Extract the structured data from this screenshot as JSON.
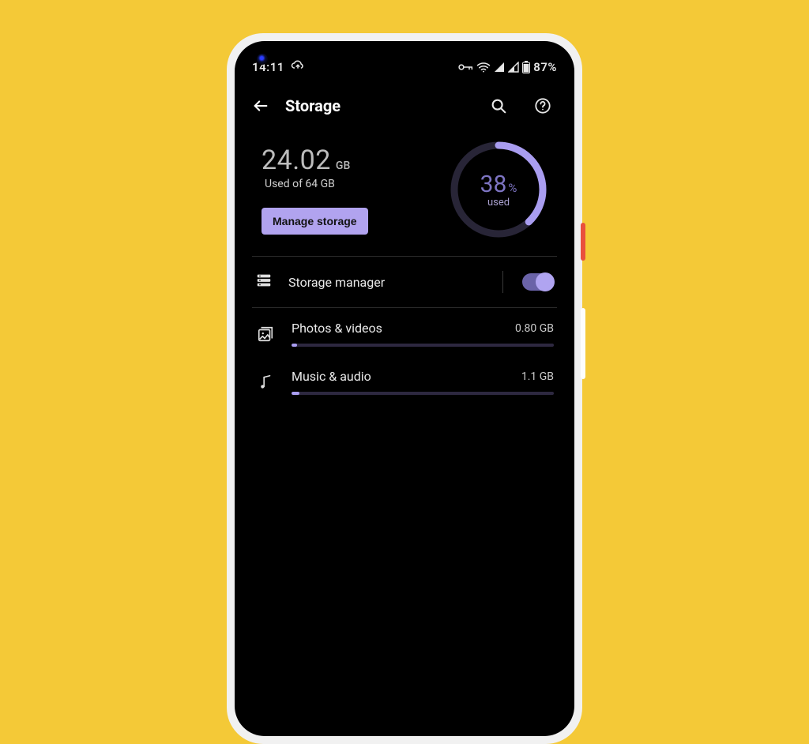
{
  "status": {
    "time": "14:11",
    "battery_text": "87%"
  },
  "appbar": {
    "title": "Storage"
  },
  "summary": {
    "used_value": "24.02",
    "used_unit": "GB",
    "used_sub": "Used of 64 GB",
    "manage_label": "Manage storage",
    "percent_value": "38",
    "percent_symbol": "%",
    "percent_sub": "used",
    "percent_fraction": 0.38
  },
  "storage_manager": {
    "label": "Storage manager",
    "enabled": true
  },
  "rows": [
    {
      "label": "Photos & videos",
      "value": "0.80 GB",
      "fill": 0.02
    },
    {
      "label": "Music & audio",
      "value": "1.1 GB",
      "fill": 0.03
    }
  ],
  "colors": {
    "accent": "#b0a4f1",
    "ring_track": "#282537",
    "ring_fill": "#a99df0"
  }
}
